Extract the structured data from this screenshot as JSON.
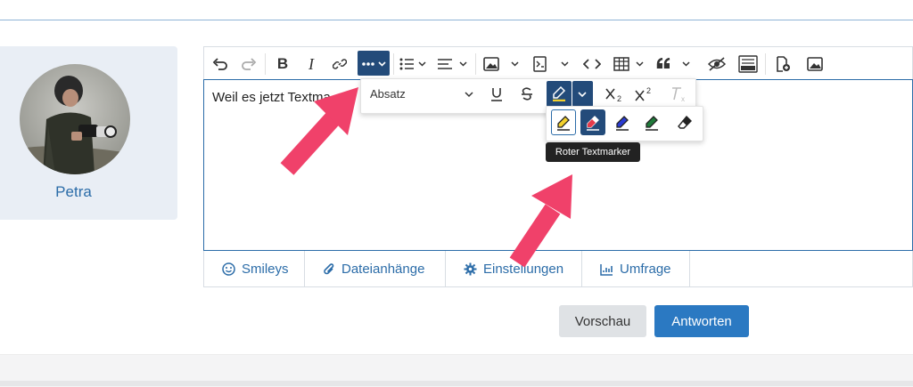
{
  "user": {
    "name": "Petra"
  },
  "editor": {
    "content": "Weil es jetzt Textma"
  },
  "popup": {
    "paragraph_select": "Absatz"
  },
  "highlight": {
    "tooltip": "Roter Textmarker",
    "colors": {
      "yellow": "#f2d02c",
      "red": "#e53b4b",
      "blue": "#2a3bd1",
      "green": "#1f7a3a"
    }
  },
  "tabs": [
    {
      "label": "Smileys",
      "icon": "smiley-icon"
    },
    {
      "label": "Dateianhänge",
      "icon": "paperclip-icon"
    },
    {
      "label": "Einstellungen",
      "icon": "gear-icon"
    },
    {
      "label": "Umfrage",
      "icon": "chart-icon"
    }
  ],
  "buttons": {
    "preview": "Vorschau",
    "submit": "Antworten"
  },
  "colors": {
    "accent": "#2b6ca8",
    "active": "#234b7a",
    "submit": "#2b79c2",
    "arrow": "#f0416a"
  }
}
